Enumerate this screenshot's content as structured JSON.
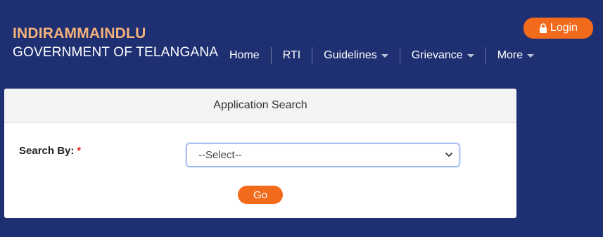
{
  "brand": {
    "title": "INDIRAMMAINDLU",
    "subtitle": "GOVERNMENT OF TELANGANA"
  },
  "login": {
    "label": "Login",
    "icon": "lock-icon"
  },
  "nav": {
    "items": [
      {
        "label": "Home",
        "has_dropdown": false
      },
      {
        "label": "RTI",
        "has_dropdown": false
      },
      {
        "label": "Guidelines",
        "has_dropdown": true
      },
      {
        "label": "Grievance",
        "has_dropdown": true
      },
      {
        "label": "More",
        "has_dropdown": true
      }
    ]
  },
  "search_card": {
    "title": "Application Search",
    "search_by_label": "Search By:",
    "required_mark": "*",
    "select_value": "--Select--",
    "go_label": "Go"
  },
  "colors": {
    "background": "#1e2f72",
    "accent": "#f26a1b",
    "brand_title": "#f5b27a"
  }
}
